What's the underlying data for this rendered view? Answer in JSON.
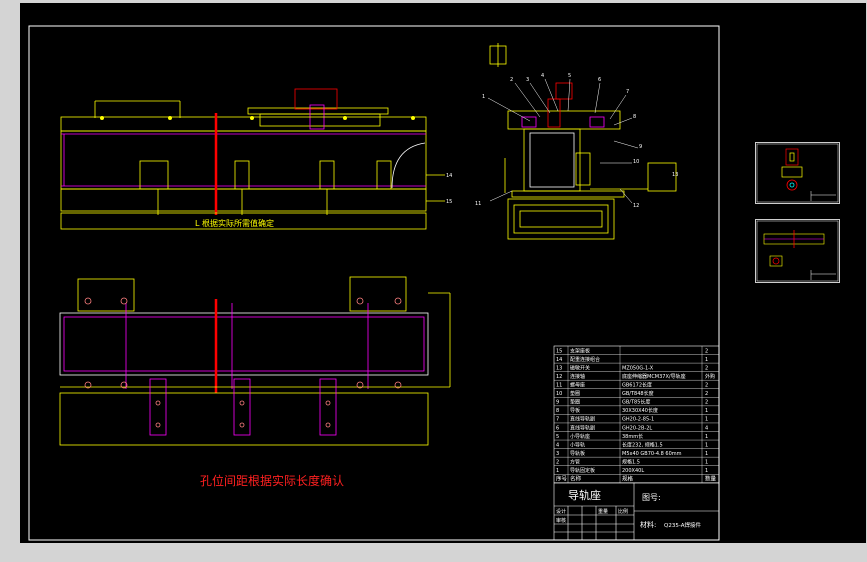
{
  "drawing": {
    "note": "孔位间距根据实际长度确认",
    "section_label": "L 根据实际所需值确定",
    "colors": {
      "background": "#000000",
      "border": "#ffffff",
      "outline": "#ffff00",
      "member": "#ff00ff",
      "centerline": "#ff0000",
      "detail": "#00ffff",
      "note": "#ff2020"
    },
    "bom": {
      "rows": [
        {
          "no": "15",
          "name": "支架座板",
          "spec": "",
          "qty": "2"
        },
        {
          "no": "14",
          "name": "配重连接组合",
          "spec": "",
          "qty": "1"
        },
        {
          "no": "13",
          "name": "磁敏开关",
          "spec": "MZ050G-1-X",
          "qty": "2"
        },
        {
          "no": "12",
          "name": "连接轴",
          "spec": "底座伸缩器MCM37X/导轨座",
          "qty": "外购"
        },
        {
          "no": "11",
          "name": "螺母座",
          "spec": "GB6172长度",
          "qty": "2"
        },
        {
          "no": "10",
          "name": "垫圈",
          "spec": "GB/T848长度",
          "qty": "2"
        },
        {
          "no": "9",
          "name": "垫圈",
          "spec": "GB/T85长度",
          "qty": "2"
        },
        {
          "no": "8",
          "name": "导板",
          "spec": "30X30X40长度",
          "qty": "1"
        },
        {
          "no": "7",
          "name": "直线导轨副",
          "spec": "GH20-2-85-1",
          "qty": "1"
        },
        {
          "no": "6",
          "name": "直线导轨副",
          "spec": "GH20-2B-2L",
          "qty": "4"
        },
        {
          "no": "5",
          "name": "小导轨座",
          "spec": "38mm长",
          "qty": "1"
        },
        {
          "no": "4",
          "name": "小导轨",
          "spec": "长度232, 规格1.5",
          "qty": "1"
        },
        {
          "no": "3",
          "name": "导轨板",
          "spec": "M5x40 GB70-4.8 60mm",
          "qty": "1"
        },
        {
          "no": "2",
          "name": "方管",
          "spec": "规格1.5",
          "qty": "1"
        },
        {
          "no": "1",
          "name": "导轨固定板",
          "spec": "200X40L",
          "qty": "1"
        }
      ],
      "header": {
        "no": "序号",
        "name": "名称",
        "spec": "规格",
        "qty": "数量"
      }
    },
    "title_block": {
      "title": "导轨座",
      "drawing_no_label": "图号:",
      "material_label": "材料:",
      "material_value": "Q235-A焊接件",
      "weight_label": "重量",
      "scale_label": "比例",
      "design_label": "设计",
      "check_label": "审核"
    },
    "callouts": [
      "1",
      "2",
      "3",
      "4",
      "5",
      "6",
      "7",
      "8",
      "9",
      "10",
      "11",
      "12",
      "13",
      "14",
      "15"
    ]
  },
  "thumbnails": [
    {
      "name": "thumbnail-side-view"
    },
    {
      "name": "thumbnail-front-view"
    }
  ]
}
